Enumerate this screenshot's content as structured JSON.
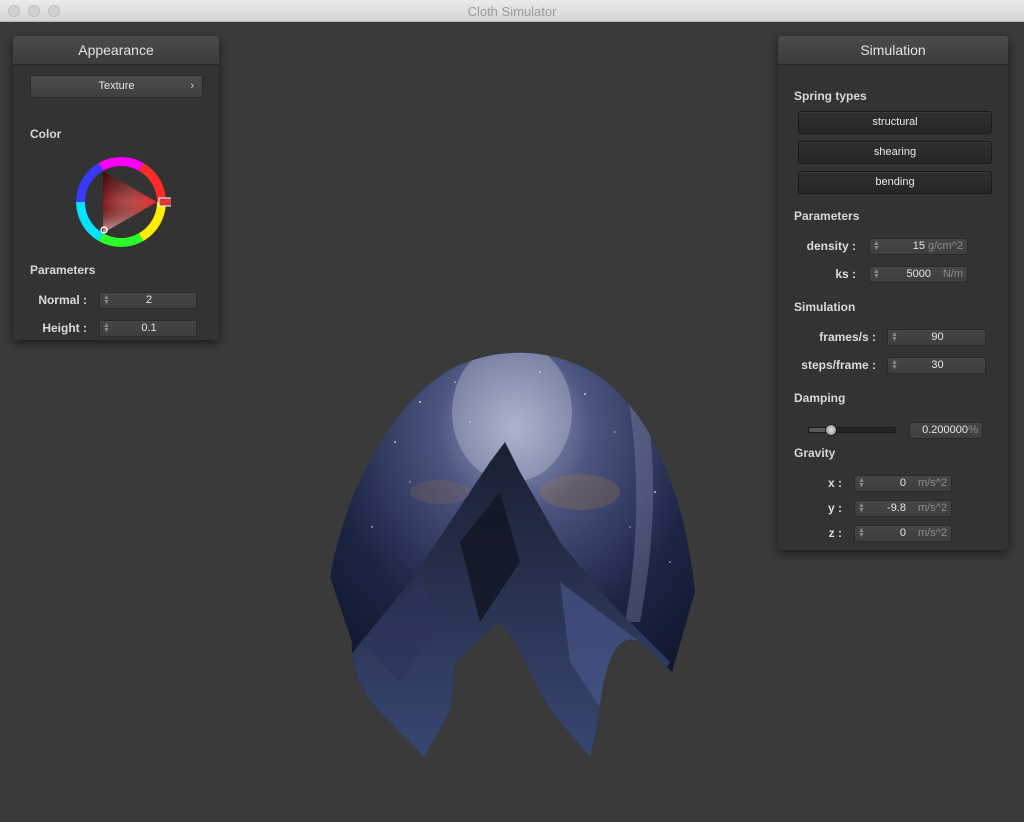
{
  "window": {
    "title": "Cloth Simulator"
  },
  "appearance": {
    "title": "Appearance",
    "texture_label": "Texture",
    "color_label": "Color",
    "params_label": "Parameters",
    "normal_label": "Normal :",
    "normal_value": "2",
    "height_label": "Height :",
    "height_value": "0.1"
  },
  "simulation": {
    "title": "Simulation",
    "spring_types_label": "Spring types",
    "springs": [
      "structural",
      "shearing",
      "bending"
    ],
    "params_label": "Parameters",
    "density_label": "density :",
    "density_value": "15",
    "density_unit": "g/cm^2",
    "ks_label": "ks :",
    "ks_value": "5000",
    "ks_unit": "N/m",
    "sim_label": "Simulation",
    "fps_label": "frames/s :",
    "fps_value": "90",
    "steps_label": "steps/frame :",
    "steps_value": "30",
    "damping_label": "Damping",
    "damping_value": "0.200000",
    "damping_unit": "%",
    "damping_fraction": 0.2,
    "gravity_label": "Gravity",
    "gx_label": "x :",
    "gx_value": "0",
    "gy_label": "y :",
    "gy_value": "-9.8",
    "gz_label": "z :",
    "gz_value": "0",
    "g_unit": "m/s^2"
  },
  "icons": {
    "chevron": "chevron-right-icon",
    "spinner": "stepper-icon"
  },
  "colors": {
    "selected_color": "#d83a3a",
    "background": "#3a3a3a",
    "panel": "#333333"
  }
}
